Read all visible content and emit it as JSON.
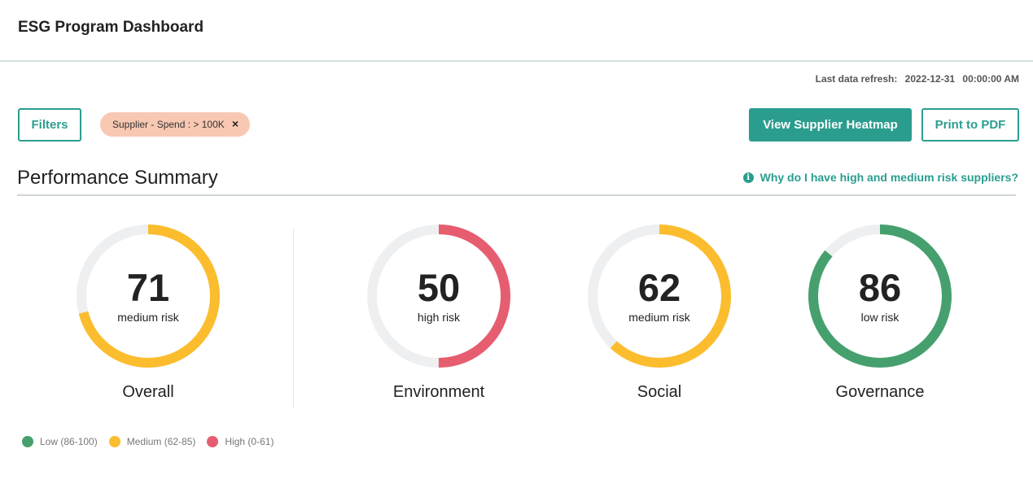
{
  "header": {
    "title": "ESG Program Dashboard"
  },
  "refresh": {
    "label": "Last data refresh:",
    "date": "2022-12-31",
    "time": "00:00:00 AM"
  },
  "toolbar": {
    "filters_label": "Filters",
    "chip_label": "Supplier - Spend : > 100K",
    "chip_close": "×",
    "heatmap_label": "View Supplier Heatmap",
    "pdf_label": "Print to PDF"
  },
  "summary": {
    "title": "Performance Summary",
    "help_icon": "i",
    "help_text": "Why do I have high and medium risk suppliers?"
  },
  "colors": {
    "low": "#46a06e",
    "medium": "#fbbd2e",
    "high": "#e65d70",
    "track": "#eeeff1",
    "accent": "#2a9d8f"
  },
  "gauges": [
    {
      "label": "Overall",
      "score": "71",
      "risk": "medium risk",
      "level": "medium",
      "fill_fraction": 0.71
    },
    {
      "label": "Environment",
      "score": "50",
      "risk": "high risk",
      "level": "high",
      "fill_fraction": 0.5
    },
    {
      "label": "Social",
      "score": "62",
      "risk": "medium risk",
      "level": "medium",
      "fill_fraction": 0.62
    },
    {
      "label": "Governance",
      "score": "86",
      "risk": "low risk",
      "level": "low",
      "fill_fraction": 0.86
    }
  ],
  "legend": [
    {
      "label": "Low (86-100)",
      "level": "low"
    },
    {
      "label": "Medium (62-85)",
      "level": "medium"
    },
    {
      "label": "High (0-61)",
      "level": "high"
    }
  ]
}
